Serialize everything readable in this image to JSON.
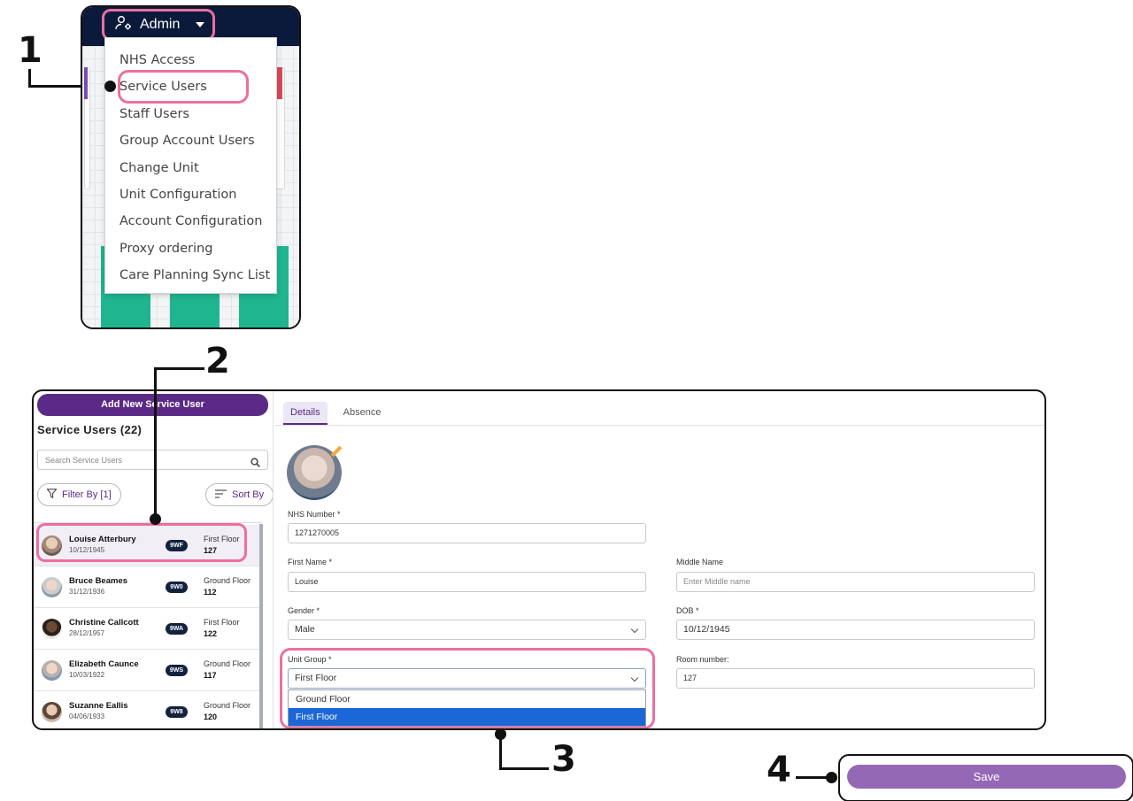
{
  "callouts": {
    "one": "1",
    "two": "2",
    "three": "3",
    "four": "4"
  },
  "admin": {
    "button_label": "Admin",
    "menu_items": [
      "NHS Access",
      "Service Users",
      "Staff Users",
      "Group Account Users",
      "Change Unit",
      "Unit Configuration",
      "Account Configuration",
      "Proxy ordering",
      "Care Planning Sync List"
    ]
  },
  "sidebar": {
    "add_button": "Add New Service User",
    "title": "Service Users (22)",
    "search_placeholder": "Search Service Users",
    "filter_label": "Filter By [1]",
    "sort_label": "Sort By",
    "users": [
      {
        "name": "Louise Atterbury",
        "dob": "10/12/1945",
        "badge": "9WF",
        "floor": "First Floor",
        "room": "127"
      },
      {
        "name": "Bruce Beames",
        "dob": "31/12/1936",
        "badge": "9W0",
        "floor": "Ground Floor",
        "room": "112"
      },
      {
        "name": "Christine Callcott",
        "dob": "28/12/1957",
        "badge": "9WA",
        "floor": "First Floor",
        "room": "122"
      },
      {
        "name": "Elizabeth Caunce",
        "dob": "10/03/1922",
        "badge": "9WS",
        "floor": "Ground Floor",
        "room": "117"
      },
      {
        "name": "Suzanne Eallis",
        "dob": "04/06/1933",
        "badge": "9W8",
        "floor": "Ground Floor",
        "room": "120"
      }
    ]
  },
  "tabs": {
    "details": "Details",
    "absence": "Absence"
  },
  "form": {
    "nhs_label": "NHS Number *",
    "nhs_value": "1271270005",
    "first_label": "First Name *",
    "first_value": "Louise",
    "middle_label": "Middle Name",
    "middle_placeholder": "Enter Middle name",
    "gender_label": "Gender *",
    "gender_value": "Male",
    "dob_label": "DOB *",
    "dob_value": "10/12/1945",
    "unit_label": "Unit Group *",
    "unit_value": "First Floor",
    "room_label": "Room number:",
    "room_value": "127",
    "unit_options": [
      "Ground Floor",
      "First Floor"
    ]
  },
  "save_label": "Save",
  "colors": {
    "accent": "#5b2a86",
    "highlight": "#ec6fa0",
    "teal": "#1fb58f",
    "navy": "#0b1a3a",
    "select_blue": "#1c67d8"
  }
}
